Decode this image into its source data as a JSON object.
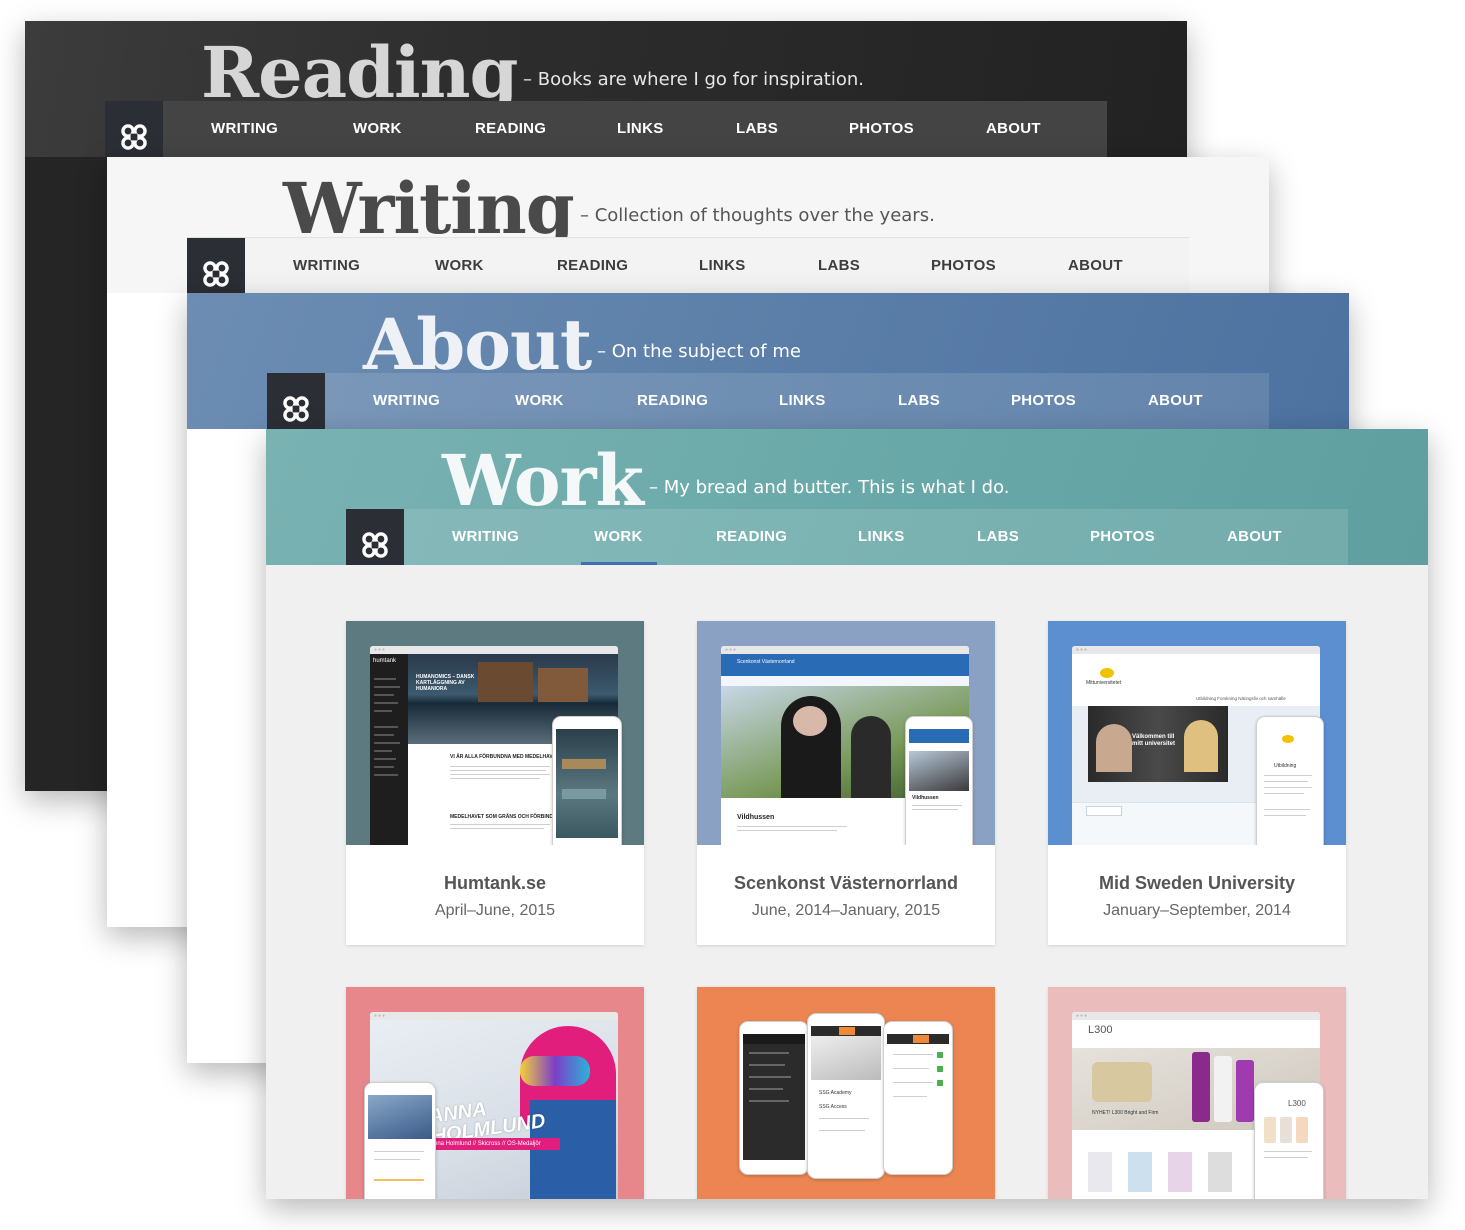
{
  "nav": [
    "WRITING",
    "WORK",
    "READING",
    "LINKS",
    "LABS",
    "PHOTOS",
    "ABOUT"
  ],
  "windows": {
    "reading": {
      "title": "Reading",
      "tagline": "– Books are where I go for inspiration."
    },
    "writing": {
      "title": "Writing",
      "tagline": "– Collection of thoughts over the years."
    },
    "about": {
      "title": "About",
      "tagline": "– On the subject of me"
    },
    "work": {
      "title": "Work",
      "tagline": "– My bread and butter. This is what I do."
    }
  },
  "projects": [
    {
      "title": "Humtank.se",
      "date": "April–June, 2015",
      "bg": "#5c7a80"
    },
    {
      "title": "Scenkonst Västernorrland",
      "date": "June, 2014–January, 2015",
      "bg": "#8ba1c4"
    },
    {
      "title": "Mid Sweden University",
      "date": "January–September, 2014",
      "bg": "#5b8fd0"
    },
    {
      "title": "",
      "date": "",
      "bg": "#e8878b"
    },
    {
      "title": "",
      "date": "",
      "bg": "#ec8552"
    },
    {
      "title": "",
      "date": "",
      "bg": "#ebbcbc"
    }
  ],
  "thumbs": {
    "humtank": {
      "brand": "humtank",
      "headline": "HUMANOMICS – DANSK KARTLÄGGNING AV HUMANIORA",
      "post1": "VI ÄR ALLA FÖRBUNDNA MED MEDELHAVET",
      "post2": "MEDELHAVET SOM GRÄNS OCH FÖRBINDELSE"
    },
    "scenkonst": {
      "brand": "Scenkonst Västernorrland",
      "caption": "Vildhussen",
      "phone_caption": "Vildhussen"
    },
    "miun": {
      "brand": "Mittuniversitetet",
      "hero": "Välkommen till mitt universitet",
      "nav": "Utbildning  Forskning  Näringsliv och samhälle",
      "phone_nav": "Utbildning"
    },
    "anna": {
      "name": "ANNA HOLMLUND",
      "strip": "Anna Holmlund // Skicross // OS-Medaljör"
    },
    "app": {
      "tile1": "SSG Academy",
      "tile2": "SSG Access"
    },
    "l300": {
      "brand": "L300",
      "product": "NYHET! L300 Bright and Firm",
      "phone_brand": "L300"
    }
  },
  "colors": {
    "active_tab": "#3e6fb0",
    "logo_bg": "#2b2f35"
  }
}
